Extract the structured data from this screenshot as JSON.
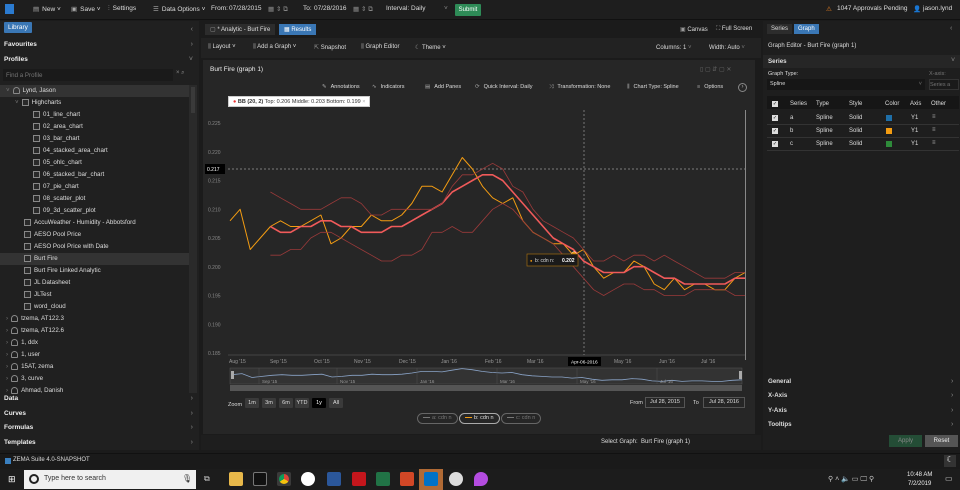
{
  "topbar": {
    "new": "New",
    "save": "Save",
    "settings": "Settings",
    "data_options": "Data Options",
    "from_label": "From:",
    "from": "07/28/2015",
    "to_label": "To:",
    "to": "07/28/2016",
    "interval_label": "Interval:",
    "interval": "Daily",
    "submit": "Submit",
    "approvals": "1047 Approvals Pending",
    "user": "jason.lynd"
  },
  "left": {
    "library": "Library",
    "favourites": "Favourites",
    "profiles": "Profiles",
    "search_placeholder": "Find a Profile",
    "tree": [
      {
        "label": "Lynd, Jason",
        "type": "user",
        "level": 0,
        "selected": true
      },
      {
        "label": "Highcharts",
        "type": "folder",
        "level": 1
      },
      {
        "label": "01_line_chart",
        "type": "chart",
        "level": 2
      },
      {
        "label": "02_area_chart",
        "type": "chart",
        "level": 2
      },
      {
        "label": "03_bar_chart",
        "type": "chart",
        "level": 2
      },
      {
        "label": "04_stacked_area_chart",
        "type": "chart",
        "level": 2
      },
      {
        "label": "05_ohlc_chart",
        "type": "chart",
        "level": 2
      },
      {
        "label": "06_stacked_bar_chart",
        "type": "chart",
        "level": 2
      },
      {
        "label": "07_pie_chart",
        "type": "chart",
        "level": 2
      },
      {
        "label": "08_scatter_plot",
        "type": "chart",
        "level": 2
      },
      {
        "label": "09_3d_scatter_plot",
        "type": "chart",
        "level": 2
      },
      {
        "label": "AccuWeather - Humidity - Abbotsford",
        "type": "chart",
        "level": 1
      },
      {
        "label": "AESO Pool Price",
        "type": "chart",
        "level": 1
      },
      {
        "label": "AESO Pool Price with Date",
        "type": "chart",
        "level": 1
      },
      {
        "label": "Burt Fire",
        "type": "chart",
        "level": 1,
        "selected": true
      },
      {
        "label": "Burt Fire Linked Analytic",
        "type": "chart",
        "level": 1
      },
      {
        "label": "JL Datasheet",
        "type": "sheet",
        "level": 1
      },
      {
        "label": "JLTest",
        "type": "chart",
        "level": 1
      },
      {
        "label": "word_cloud",
        "type": "chart",
        "level": 1
      },
      {
        "label": "tzema, AT122.3",
        "type": "user",
        "level": 0
      },
      {
        "label": "tzema, AT122.6",
        "type": "user",
        "level": 0
      },
      {
        "label": "1, ddx",
        "type": "user",
        "level": 0
      },
      {
        "label": "1, user",
        "type": "user",
        "level": 0
      },
      {
        "label": "15AT, zema",
        "type": "user",
        "level": 0
      },
      {
        "label": "3, curve",
        "type": "user",
        "level": 0
      },
      {
        "label": "Ahmad, Danish",
        "type": "user",
        "level": 0
      }
    ],
    "sections": [
      "Data",
      "Curves",
      "Formulas",
      "Templates"
    ]
  },
  "center": {
    "tab_analytic": "* Analytic - Burt Fire",
    "tab_results": "Results",
    "canvas": "Canvas",
    "fullscreen": "Full Screen",
    "layout": "Layout",
    "add_graph": "Add a Graph",
    "snapshot": "Snapshot",
    "graph_editor": "Graph Editor",
    "theme": "Theme",
    "columns_label": "Columns:",
    "columns": "1",
    "width_label": "Width:",
    "width": "Auto",
    "graph_title": "Burt Fire (graph 1)",
    "tools": [
      "Annotations",
      "Indicators",
      "Add Panes",
      "Quick Interval: Daily",
      "Transformation: None",
      "Chart Type: Spline",
      "Options"
    ],
    "info_tooltip": {
      "name": "BB (20, 2)",
      "text": "Top: 0.206 Middle: 0.203 Bottom: 0.199",
      "close": "×"
    },
    "hover_tooltip": {
      "label": "b: cdn n:",
      "value": "0.202"
    },
    "crosshair_y": "0.217",
    "crosshair_x": "Apr-06-2016",
    "zoom_label": "Zoom",
    "zoom_buttons": [
      "1m",
      "3m",
      "6m",
      "YTD",
      "1y",
      "All"
    ],
    "zoom_active": "1y",
    "from_label": "From",
    "from": "Jul 28, 2015",
    "to_label": "To",
    "to": "Jul 28, 2016",
    "legend": [
      {
        "label": "a: cdn n",
        "active": false
      },
      {
        "label": "b: cdn n",
        "active": true
      },
      {
        "label": "c: cdn n",
        "active": false
      }
    ],
    "navigator_labels": [
      "Sep '15",
      "Nov '15",
      "Jan '16",
      "Mar '16",
      "May '16",
      "Jul '16"
    ],
    "select_graph_label": "Select Graph:",
    "select_graph": "Burt Fire (graph 1)"
  },
  "right": {
    "tab_series": "Series",
    "tab_graph": "Graph",
    "title": "Graph Editor - Burt Fire (graph 1)",
    "series_section": "Series",
    "graph_type_label": "Graph Type:",
    "graph_type": "Spline",
    "xaxis_label": "X-axis:",
    "xaxis_placeholder": "Series a",
    "columns": [
      "Series",
      "Type",
      "Style",
      "Color",
      "Axis",
      "Other"
    ],
    "rows": [
      {
        "series": "a",
        "type": "Spline",
        "style": "Solid",
        "color": "#1f6fa8",
        "axis": "Y1"
      },
      {
        "series": "b",
        "type": "Spline",
        "style": "Solid",
        "color": "#f39c12",
        "axis": "Y1"
      },
      {
        "series": "c",
        "type": "Spline",
        "style": "Solid",
        "color": "#2e8b3a",
        "axis": "Y1"
      }
    ],
    "sections": [
      "General",
      "X-Axis",
      "Y-Axis",
      "Tooltips"
    ],
    "apply": "Apply",
    "reset": "Reset"
  },
  "statusbar": {
    "app": "ZEMA Suite 4.0-SNAPSHOT"
  },
  "taskbar": {
    "search_placeholder": "Type here to search",
    "time": "10:48 AM",
    "date": "7/2/2019"
  },
  "chart_data": {
    "type": "line",
    "title": "Burt Fire (graph 1)",
    "x_unit": "week since Aug 1 2015",
    "ylim": [
      0.185,
      0.225
    ],
    "yticks": [
      "0.225",
      "0.220",
      "0.215",
      "0.210",
      "0.205",
      "0.200",
      "0.195",
      "0.190",
      "0.185"
    ],
    "xticks": [
      "Aug '15",
      "Sep '15",
      "Oct '15",
      "Nov '15",
      "Dec '15",
      "Jan '16",
      "Feb '16",
      "Mar '16",
      "Apr '16",
      "May '16",
      "Jun '16",
      "Jul '16"
    ],
    "series": [
      {
        "name": "b: cdn n",
        "color": "#f39c12",
        "values": [
          0.208,
          0.21,
          0.203,
          0.205,
          0.207,
          0.208,
          0.207,
          0.207,
          0.208,
          0.209,
          0.204,
          0.205,
          0.207,
          0.207,
          0.209,
          0.208,
          0.208,
          0.209,
          0.211,
          0.214,
          0.214,
          0.213,
          0.216,
          0.219,
          0.217,
          0.214,
          0.212,
          0.211,
          0.212,
          0.208,
          0.206,
          0.205,
          0.204,
          0.204,
          0.202,
          0.203,
          0.2,
          0.198,
          0.199,
          0.199,
          0.201,
          0.2,
          0.197,
          0.196,
          0.198,
          0.196,
          0.197,
          0.197,
          0.196,
          0.196,
          0.198,
          0.199
        ]
      },
      {
        "name": "BB (20, 2) Middle",
        "color": "#f05a5a",
        "start": 4,
        "values": [
          0.207,
          0.206,
          0.206,
          0.207,
          0.207,
          0.208,
          0.208,
          0.207,
          0.207,
          0.206,
          0.206,
          0.206,
          0.207,
          0.207,
          0.208,
          0.209,
          0.21,
          0.211,
          0.213,
          0.214,
          0.215,
          0.216,
          0.216,
          0.215,
          0.213,
          0.211,
          0.209,
          0.207,
          0.205,
          0.204,
          0.203,
          0.201,
          0.2,
          0.199,
          0.199,
          0.199,
          0.2,
          0.2,
          0.199,
          0.198,
          0.198,
          0.197,
          0.197,
          0.197,
          0.197,
          0.197,
          0.198,
          0.198
        ]
      },
      {
        "name": "BB (20, 2) Top",
        "color": "#9a3a3a",
        "start": 4,
        "values": [
          0.213,
          0.212,
          0.211,
          0.21,
          0.21,
          0.21,
          0.211,
          0.212,
          0.212,
          0.211,
          0.209,
          0.209,
          0.21,
          0.21,
          0.21,
          0.21,
          0.21,
          0.211,
          0.214,
          0.216,
          0.216,
          0.217,
          0.218,
          0.217,
          0.214,
          0.213,
          0.21,
          0.208,
          0.207,
          0.206,
          0.205,
          0.203,
          0.201,
          0.201,
          0.202,
          0.201,
          0.202,
          0.202,
          0.201,
          0.202,
          0.201,
          0.2,
          0.199,
          0.198,
          0.198,
          0.198,
          0.199,
          0.199
        ]
      },
      {
        "name": "BB (20, 2) Bottom",
        "color": "#9a3a3a",
        "start": 4,
        "values": [
          0.202,
          0.202,
          0.203,
          0.203,
          0.205,
          0.206,
          0.206,
          0.205,
          0.204,
          0.203,
          0.202,
          0.201,
          0.201,
          0.202,
          0.202,
          0.203,
          0.206,
          0.206,
          0.207,
          0.206,
          0.206,
          0.208,
          0.21,
          0.211,
          0.21,
          0.208,
          0.206,
          0.205,
          0.204,
          0.202,
          0.2,
          0.198,
          0.196,
          0.195,
          0.196,
          0.197,
          0.197,
          0.196,
          0.196,
          0.195,
          0.195,
          0.195,
          0.196,
          0.196,
          0.196,
          0.196,
          0.195,
          0.195
        ]
      }
    ]
  }
}
